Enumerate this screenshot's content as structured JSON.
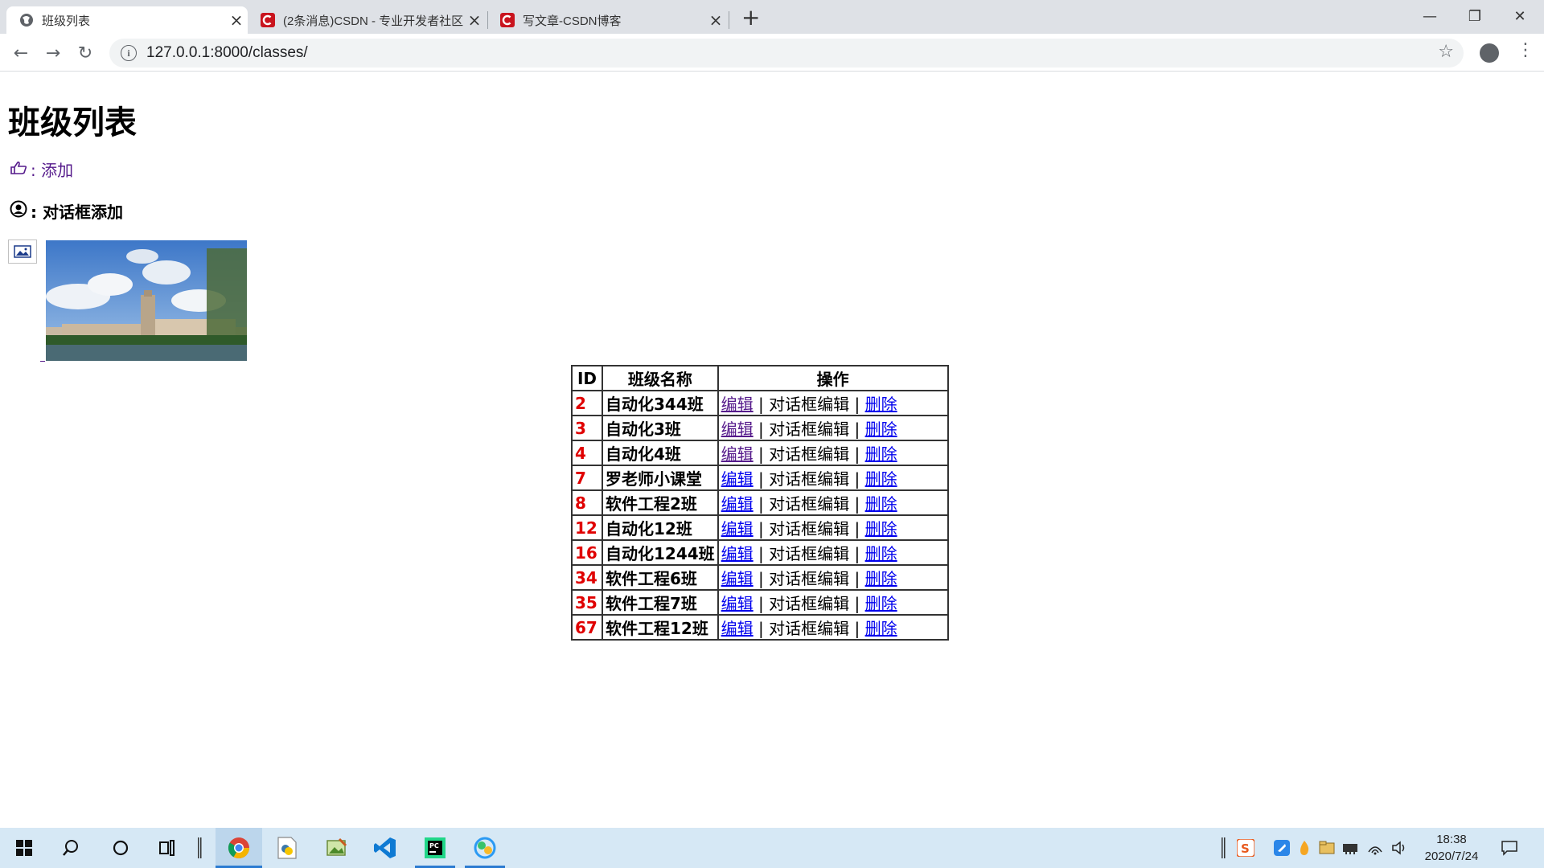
{
  "browser": {
    "tabs": [
      {
        "title": "班级列表",
        "active": true,
        "icon": "globe-icon"
      },
      {
        "title": "(2条消息)CSDN - 专业开发者社区",
        "active": false,
        "icon": "csdn-icon"
      },
      {
        "title": "写文章-CSDN博客",
        "active": false,
        "icon": "csdn-icon"
      }
    ],
    "new_tab": "+",
    "url": "127.0.0.1:8000/classes/"
  },
  "page": {
    "heading": "班级列表",
    "add_link": ": 添加",
    "dialog_add": ": 对话框添加",
    "table": {
      "headers": [
        "ID",
        "班级名称",
        "操作"
      ],
      "rows": [
        {
          "id": "2",
          "name": "自动化344班"
        },
        {
          "id": "3",
          "name": "自动化3班"
        },
        {
          "id": "4",
          "name": "自动化4班"
        },
        {
          "id": "7",
          "name": "罗老师小课堂"
        },
        {
          "id": "8",
          "name": "软件工程2班"
        },
        {
          "id": "12",
          "name": "自动化12班"
        },
        {
          "id": "16",
          "name": "自动化1244班"
        },
        {
          "id": "34",
          "name": "软件工程6班"
        },
        {
          "id": "35",
          "name": "软件工程7班"
        },
        {
          "id": "67",
          "name": "软件工程12班"
        }
      ],
      "edit_label": "编辑",
      "dialog_edit_label": "对话框编辑",
      "delete_label": "删除",
      "sep": "|"
    }
  },
  "taskbar": {
    "time": "18:38",
    "date": "2020/7/24",
    "ime": "S"
  },
  "colors": {
    "id_red": "#e00000",
    "link_blue": "#0000ee",
    "link_visited": "#551a8b",
    "taskbar_bg": "#d6e8f5"
  }
}
